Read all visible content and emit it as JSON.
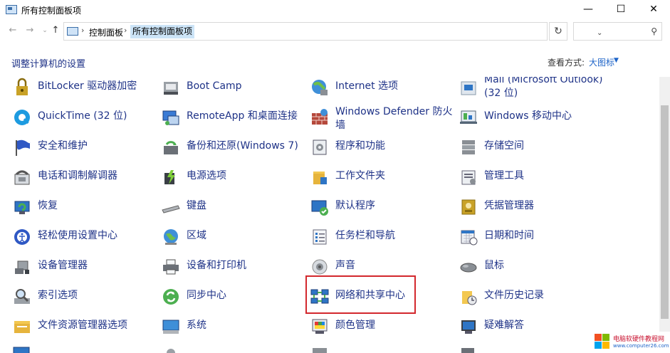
{
  "window": {
    "title": "所有控制面板项",
    "minimize": "—",
    "maximize": "☐",
    "close": "✕"
  },
  "nav": {
    "back": "←",
    "forward": "→",
    "recent": "⌄",
    "up": "↑"
  },
  "address": {
    "crumbs": [
      "控制面板",
      "所有控制面板项"
    ],
    "separator": "›",
    "dropdown": "⌄",
    "refresh": "↻"
  },
  "search": {
    "icon": "⚲",
    "placeholder": ""
  },
  "header": {
    "title": "调整计算机的设置",
    "view_label": "查看方式:",
    "view_value": "大图标",
    "view_arrow": "▼"
  },
  "items": [
    {
      "label": "BitLocker 驱动器加密",
      "icon": "bitlocker-icon"
    },
    {
      "label": "Boot Camp",
      "icon": "bootcamp-icon"
    },
    {
      "label": "Internet 选项",
      "icon": "internet-options-icon"
    },
    {
      "label": "Mail (Microsoft Outlook)",
      "label2": "(32 位)",
      "icon": "mail-icon"
    },
    {
      "label": "QuickTime (32 位)",
      "icon": "quicktime-icon"
    },
    {
      "label": "RemoteApp 和桌面连接",
      "icon": "remoteapp-icon"
    },
    {
      "label": "Windows Defender 防火",
      "label2": "墙",
      "icon": "firewall-icon"
    },
    {
      "label": "Windows 移动中心",
      "icon": "mobility-center-icon"
    },
    {
      "label": "安全和维护",
      "icon": "security-flag-icon"
    },
    {
      "label": "备份和还原(Windows 7)",
      "icon": "backup-icon"
    },
    {
      "label": "程序和功能",
      "icon": "programs-icon"
    },
    {
      "label": "存储空间",
      "icon": "storage-spaces-icon"
    },
    {
      "label": "电话和调制解调器",
      "icon": "phone-modem-icon"
    },
    {
      "label": "电源选项",
      "icon": "power-options-icon"
    },
    {
      "label": "工作文件夹",
      "icon": "work-folders-icon"
    },
    {
      "label": "管理工具",
      "icon": "admin-tools-icon"
    },
    {
      "label": "恢复",
      "icon": "recovery-icon"
    },
    {
      "label": "键盘",
      "icon": "keyboard-icon"
    },
    {
      "label": "默认程序",
      "icon": "default-programs-icon"
    },
    {
      "label": "凭据管理器",
      "icon": "credential-manager-icon"
    },
    {
      "label": "轻松使用设置中心",
      "icon": "ease-of-access-icon"
    },
    {
      "label": "区域",
      "icon": "region-icon"
    },
    {
      "label": "任务栏和导航",
      "icon": "taskbar-icon"
    },
    {
      "label": "日期和时间",
      "icon": "date-time-icon"
    },
    {
      "label": "设备管理器",
      "icon": "device-manager-icon"
    },
    {
      "label": "设备和打印机",
      "icon": "printer-icon"
    },
    {
      "label": "声音",
      "icon": "sound-icon"
    },
    {
      "label": "鼠标",
      "icon": "mouse-icon"
    },
    {
      "label": "索引选项",
      "icon": "indexing-icon"
    },
    {
      "label": "同步中心",
      "icon": "sync-center-icon"
    },
    {
      "label": "网络和共享中心",
      "icon": "network-sharing-icon"
    },
    {
      "label": "文件历史记录",
      "icon": "file-history-icon"
    },
    {
      "label": "文件资源管理器选项",
      "icon": "explorer-options-icon"
    },
    {
      "label": "系统",
      "icon": "system-icon"
    },
    {
      "label": "颜色管理",
      "icon": "color-management-icon"
    },
    {
      "label": "疑难解答",
      "icon": "troubleshooting-icon"
    }
  ],
  "watermark": {
    "line1": "电脑软硬件教程网",
    "line2": "www.computer26.com"
  }
}
